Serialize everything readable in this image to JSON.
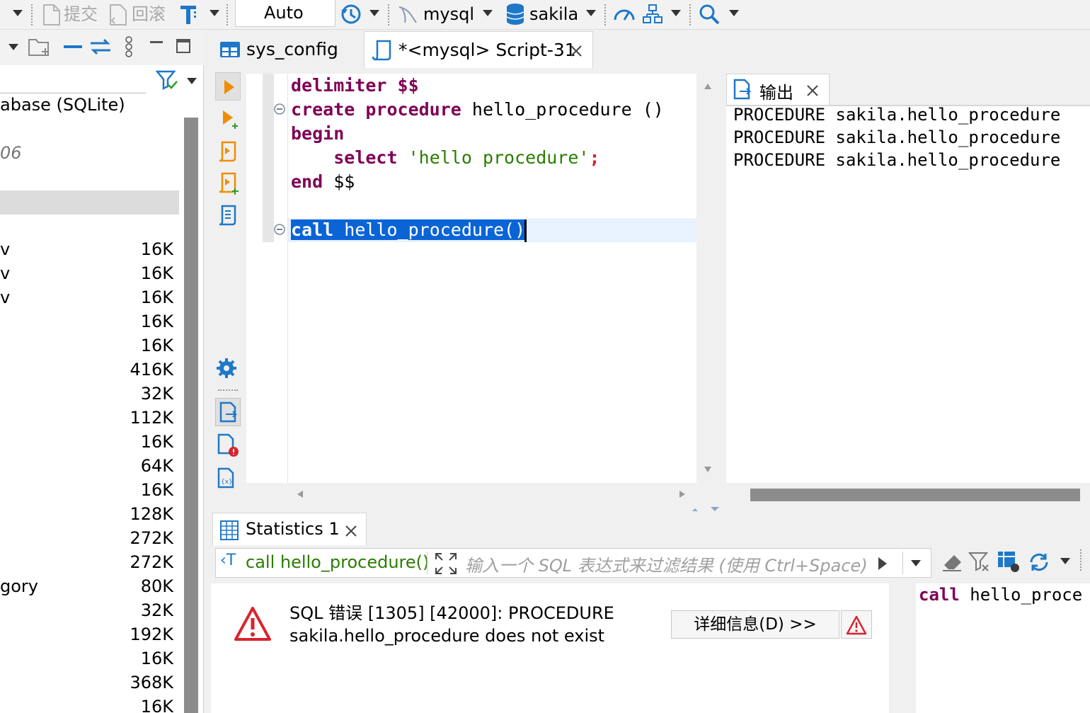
{
  "toolbar": {
    "commit_label": "提交",
    "rollback_label": "回滚",
    "transaction_mode": "Auto",
    "connection": "mysql",
    "database": "sakila"
  },
  "navigator": {
    "db_label": "abase (SQLite)",
    "version_label": "06",
    "rows": [
      {
        "name": "v",
        "size": "16K"
      },
      {
        "name": "v",
        "size": "16K"
      },
      {
        "name": "v",
        "size": "16K"
      },
      {
        "name": "",
        "size": "16K"
      },
      {
        "name": "",
        "size": "16K"
      },
      {
        "name": "",
        "size": "416K"
      },
      {
        "name": "",
        "size": "32K"
      },
      {
        "name": "",
        "size": "112K"
      },
      {
        "name": "",
        "size": "16K"
      },
      {
        "name": "",
        "size": "64K"
      },
      {
        "name": "",
        "size": "16K"
      },
      {
        "name": "",
        "size": "128K"
      },
      {
        "name": "",
        "size": "272K"
      },
      {
        "name": "",
        "size": "272K"
      },
      {
        "name": "gory",
        "size": "80K"
      },
      {
        "name": "",
        "size": "32K"
      },
      {
        "name": "",
        "size": "192K"
      },
      {
        "name": "",
        "size": "16K"
      },
      {
        "name": "",
        "size": "368K"
      },
      {
        "name": "",
        "size": "16K"
      }
    ]
  },
  "tabs": [
    {
      "label": "sys_config"
    },
    {
      "label": "*<mysql> Script-31"
    }
  ],
  "editor": {
    "line1_kw": "delimiter",
    "line1_rest": "$$",
    "line2_kw": "create procedure",
    "line2_rest": "hello_procedure ()",
    "line3_kw": "begin",
    "line4_kw": "select",
    "line4_str": "'hello procedure'",
    "line4_semi": ";",
    "line5_kw": "end",
    "line5_rest": "$$",
    "line7_kw": "call",
    "line7_rest": "hello_procedure()"
  },
  "output": {
    "tab_label": "输出",
    "lines": [
      "PROCEDURE sakila.hello_procedure",
      "PROCEDURE sakila.hello_procedure",
      "PROCEDURE sakila.hello_procedure"
    ]
  },
  "results": {
    "tab_label": "Statistics 1",
    "query_label": "call hello_procedure()",
    "filter_placeholder": "输入一个 SQL 表达式来过滤结果 (使用 Ctrl+Space)",
    "error_line1": "SQL 错误 [1305] [42000]: PROCEDURE",
    "error_line2": "sakila.hello_procedure does not exist",
    "details_button": "详细信息(D) >>",
    "side_kw": "call",
    "side_rest": "hello_proce"
  },
  "colors": {
    "accent_blue": "#1e78c8",
    "keyword": "#7f0055",
    "string": "#2a7d00",
    "selection": "#0a64d6",
    "error_red": "#d9232d",
    "run_orange": "#f08c00"
  }
}
